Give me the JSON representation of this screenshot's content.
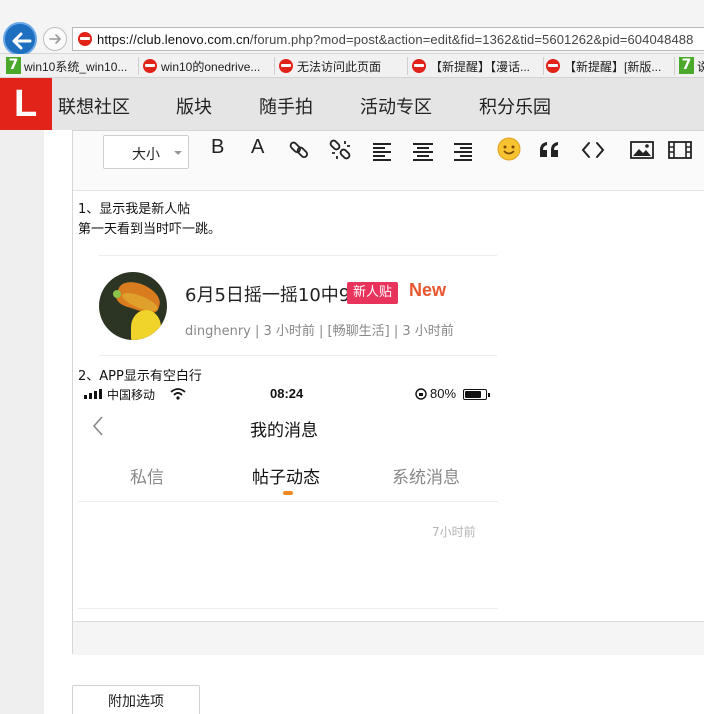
{
  "browser": {
    "url_host": "https://club.lenovo.com.cn",
    "url_path": "/forum.php?mod=post&action=edit&fid=1362&tid=5601262&pid=604048488",
    "favorites": [
      {
        "label": "win10系统_win10...",
        "icon": "seven-icon"
      },
      {
        "label": "win10的onedrive...",
        "icon": "lenovo-icon"
      },
      {
        "label": "无法访问此页面",
        "icon": "lenovo-icon"
      },
      {
        "label": "【新提醒】【漫话...",
        "icon": "lenovo-icon"
      },
      {
        "label": "【新提醒】[新版...",
        "icon": "lenovo-icon"
      },
      {
        "label": "说",
        "icon": "seven-icon"
      }
    ]
  },
  "site": {
    "logo_letter": "L",
    "nav": [
      "联想社区",
      "版块",
      "随手拍",
      "活动专区",
      "积分乐园"
    ]
  },
  "toolbar": {
    "font_size_label": "大小",
    "bold": "B",
    "font_color": "A"
  },
  "content": {
    "para1_line1": "1、显示我是新人帖",
    "para1_line2": "第一天看到当时吓一跳。",
    "post": {
      "title": "6月5日摇一摇10中9",
      "badge": "新人贴",
      "new_label": "New",
      "meta": "dinghenry | 3 小时前 | [畅聊生活] | 3 小时前"
    },
    "para2": "2、APP显示有空白行",
    "phone": {
      "carrier": "中国移动",
      "time": "08:24",
      "battery_pct": "80%",
      "battery_level": 0.8,
      "title": "我的消息",
      "tabs": [
        "私信",
        "帖子动态",
        "系统消息"
      ],
      "active_tab": 1,
      "item_time": "7小时前"
    }
  },
  "footer": {
    "extra_options": "附加选项"
  },
  "colors": {
    "brand_red": "#e2231a",
    "badge_pink": "#e8335d",
    "new_orange": "#e8552f",
    "tab_indicator": "#f08a24"
  }
}
